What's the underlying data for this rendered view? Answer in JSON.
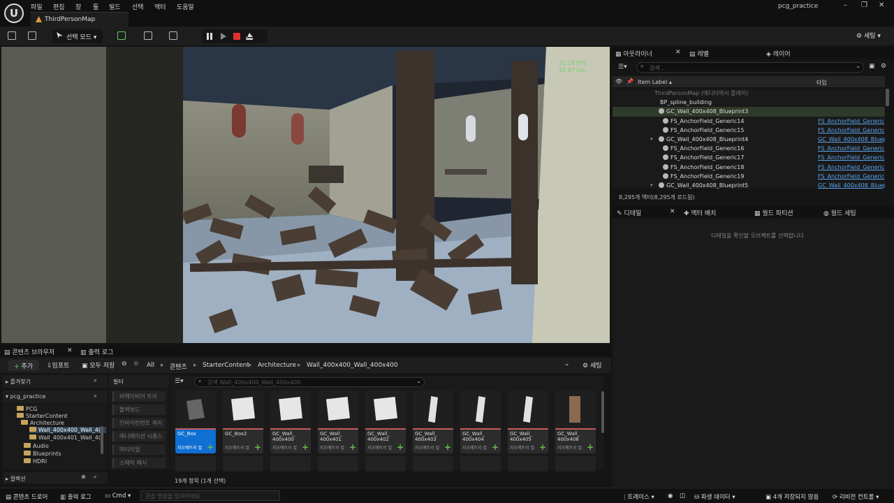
{
  "menu": [
    "파일",
    "편집",
    "창",
    "툴",
    "빌드",
    "선택",
    "액터",
    "도움말"
  ],
  "map_tab": "ThirdPersonMap",
  "project": "pcg_practice",
  "toolbar": {
    "mode": "선택 모드",
    "settings": "세팅"
  },
  "viewport": {
    "fps": "31.19 FPS",
    "ms": "32.07 ms"
  },
  "outliner": {
    "tabs": [
      "아웃라이너",
      "레벨",
      "레이어"
    ],
    "search_placeholder": "검색...",
    "col_label": "Item Label ▴",
    "col_type": "타입",
    "rows": [
      {
        "label": "ThirdPersonMap (에디터에서 플레이)",
        "type": "",
        "indent": 60,
        "dim": true
      },
      {
        "label": "BP_spline_building",
        "type": "",
        "indent": 68
      },
      {
        "label": "GC_Wall_400x408_Blueprint3",
        "type": "",
        "indent": 66,
        "icon": true,
        "sel": true
      },
      {
        "label": "FS_AnchorField_Generic14",
        "type": "FS_AnchorField_Generic",
        "indent": 72,
        "icon": true
      },
      {
        "label": "FS_AnchorField_Generic15",
        "type": "FS_AnchorField_Generic",
        "indent": 72,
        "icon": true
      },
      {
        "label": "GC_Wall_400x408_Blueprint4",
        "type": "GC_Wall_400x408_Bluepr",
        "indent": 66,
        "icon": true,
        "arrow": true
      },
      {
        "label": "FS_AnchorField_Generic16",
        "type": "FS_AnchorField_Generic",
        "indent": 72,
        "icon": true
      },
      {
        "label": "FS_AnchorField_Generic17",
        "type": "FS_AnchorField_Generic",
        "indent": 72,
        "icon": true
      },
      {
        "label": "FS_AnchorField_Generic18",
        "type": "FS_AnchorField_Generic",
        "indent": 72,
        "icon": true
      },
      {
        "label": "FS_AnchorField_Generic19",
        "type": "FS_AnchorField_Generic",
        "indent": 72,
        "icon": true
      },
      {
        "label": "GC_Wall_400x408_Blueprint5",
        "type": "GC_Wall_400x408_Bluepr",
        "indent": 66,
        "icon": true,
        "arrow": true
      }
    ],
    "count": "8,295개 액터(8,295개 로드됨)"
  },
  "details": {
    "tabs": [
      "디테일",
      "액터 배치",
      "월드 파티션",
      "월드 세팅"
    ],
    "message": "디테일을 확인할 오브젝트를 선택합니다"
  },
  "content_browser": {
    "tabs": [
      "콘텐츠 브라우저",
      "출력 로그"
    ],
    "add": "추가",
    "import": "임포트",
    "save_all": "모두 저장",
    "crumbs": [
      "All",
      "콘텐츠",
      "StarterContent",
      "Architecture",
      "Wall_400x400_Wall_400x400"
    ],
    "settings": "세팅",
    "favorites": "즐겨찾기",
    "project": "pcg_practice",
    "filter": "필터",
    "tree": [
      "PCG",
      "StarterContent",
      "Architecture",
      "Wall_400x400_Wall_4(",
      "Wall_400x401_Wall_4(",
      "Audio",
      "Blueprints",
      "HDRI"
    ],
    "filters": [
      "비헤이비어 트리",
      "블랙보드",
      "인바이런먼트 쿼리",
      "애니메이션 시퀀스",
      "머티리얼",
      "스태틱 메시"
    ],
    "search_placeholder": "검색 Wall_400x400_Wall_400x400",
    "assets": [
      {
        "name": "GC_Box",
        "sub": "지오메트리 컬"
      },
      {
        "name": "GC_Box2",
        "sub": "지오메트리 컬"
      },
      {
        "name": "GC_Wall_\n400x400",
        "sub": "지오메트리 컬"
      },
      {
        "name": "GC_Wall_\n400x401",
        "sub": "지오메트리 컬"
      },
      {
        "name": "GC_Wall_\n400x402",
        "sub": "지오메트리 컬"
      },
      {
        "name": "GC_Wall_\n400x403",
        "sub": "지오메트리 컬"
      },
      {
        "name": "GC_Wall_\n400x404",
        "sub": "지오메트리 컬"
      },
      {
        "name": "GC_Wall_\n400x405",
        "sub": "지오메트리 컬"
      },
      {
        "name": "GC_Wall_\n400x406",
        "sub": "지오메트리 컬"
      }
    ],
    "item_count": "19개 항목 (1개 선택)",
    "collection": "컬렉션"
  },
  "status": {
    "drawer": "콘텐츠 드로어",
    "output": "출력 로그",
    "cmd": "Cmd",
    "cmd_placeholder": "콘솔 명령을 입력하세요",
    "trace": "트레이스",
    "derived": "파생 데이터",
    "unsaved": "4개 저장되지 않음",
    "revision": "리비전 컨트롤"
  }
}
